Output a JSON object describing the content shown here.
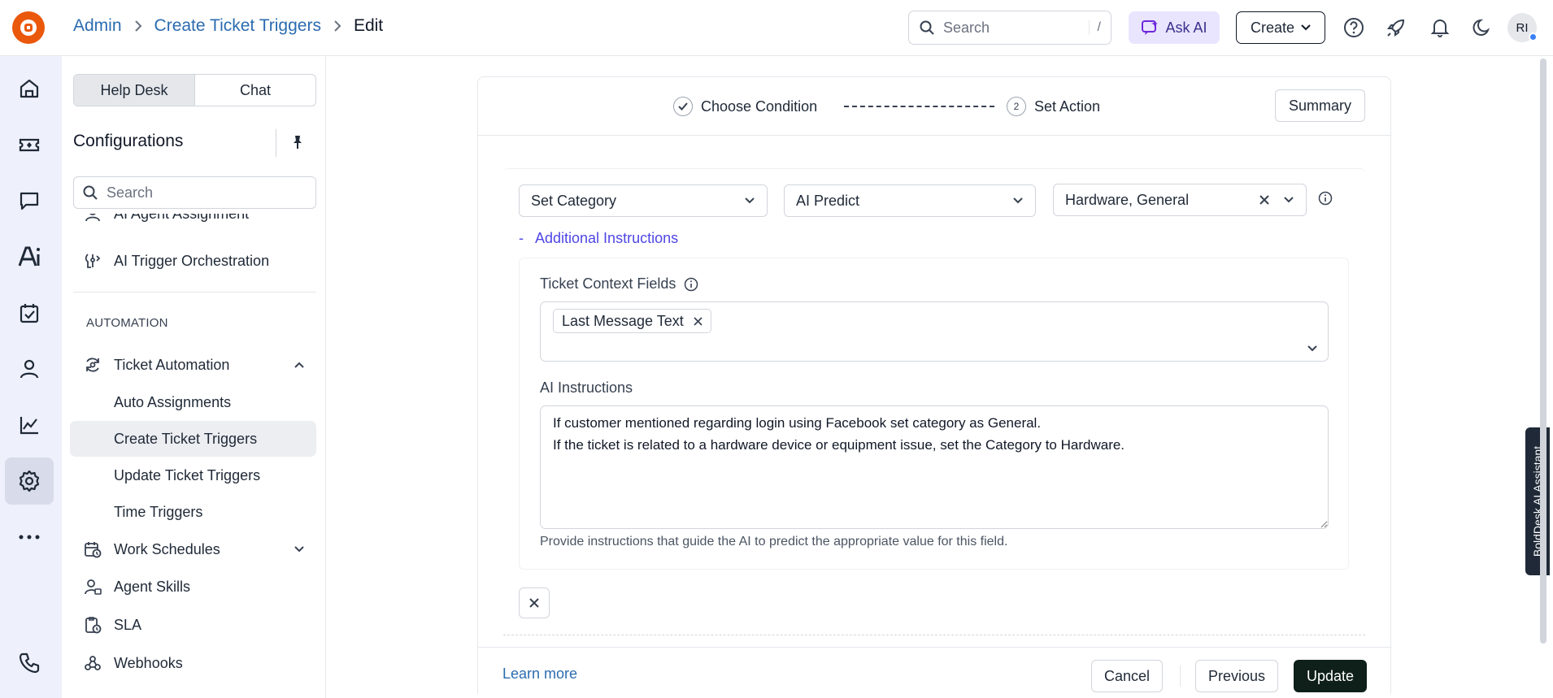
{
  "breadcrumb": {
    "root": "Admin",
    "parent": "Create Ticket Triggers",
    "current": "Edit"
  },
  "topbar": {
    "search_placeholder": "Search",
    "search_shortcut": "/",
    "ask_ai_label": "Ask AI",
    "create_label": "Create",
    "avatar_initials": "RI"
  },
  "sidebar": {
    "segments": [
      "Help Desk",
      "Chat"
    ],
    "title": "Configurations",
    "search_placeholder": "Search",
    "clipped_item": "AI Agent Assignment",
    "ai_trigger_item": "AI Trigger Orchestration",
    "section_automation": "AUTOMATION",
    "ticket_automation": "Ticket Automation",
    "sub_items": [
      "Auto Assignments",
      "Create Ticket Triggers",
      "Update Ticket Triggers",
      "Time Triggers"
    ],
    "work_schedules": "Work Schedules",
    "agent_skills": "Agent Skills",
    "sla": "SLA",
    "webhooks": "Webhooks"
  },
  "steps": {
    "step1_label": "Choose Condition",
    "step2_number": "2",
    "step2_label": "Set Action",
    "summary_label": "Summary"
  },
  "action": {
    "field": "Set Category",
    "method": "AI Predict",
    "values": "Hardware, General",
    "additional_toggle": "-",
    "additional_label": "Additional Instructions",
    "context_label": "Ticket Context Fields",
    "context_chip": "Last Message Text",
    "ai_instructions_label": "AI Instructions",
    "ai_instructions_value": "If customer mentioned regarding login using Facebook set category as General.\nIf the ticket is related to a hardware device or equipment issue, set the Category to Hardware.",
    "hint": "Provide instructions that guide the AI to predict the appropriate value for this field."
  },
  "footer": {
    "learn_more": "Learn more",
    "cancel": "Cancel",
    "previous": "Previous",
    "update": "Update"
  },
  "assistant_tab": "BoldDesk AI Assistant",
  "colors": {
    "brand": "#ea580c",
    "link": "#2b6cb0",
    "accent": "#4f46e5",
    "primary_button": "#0f1f1a"
  }
}
